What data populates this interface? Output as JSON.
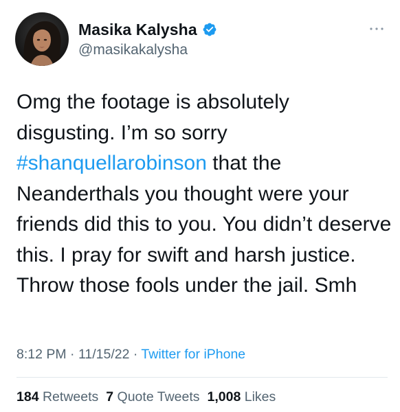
{
  "colors": {
    "accent": "#1d9bf0",
    "text_primary": "#0f1419",
    "text_secondary": "#536471",
    "divider": "#e1e8ed"
  },
  "author": {
    "display_name": "Masika Kalysha",
    "handle": "@masikakalysha",
    "verified_icon": "verified-badge-icon",
    "avatar_icon": "profile-photo"
  },
  "more_icon": "ellipsis-icon",
  "tweet": {
    "text_before": "Omg the footage is absolutely disgusting. I’m so sorry ",
    "hashtag": "#shanquellarobinson",
    "text_after": " that the Neanderthals you thought were your friends did this to you. You didn’t deserve this. I pray for swift and harsh justice. Throw those fools under the jail. Smh"
  },
  "meta": {
    "time": "8:12 PM",
    "separator": " · ",
    "date": "11/15/22",
    "source": "Twitter for iPhone"
  },
  "stats": {
    "retweets_count": "184",
    "retweets_label": "Retweets",
    "quotes_count": "7",
    "quotes_label": "Quote Tweets",
    "likes_count": "1,008",
    "likes_label": "Likes"
  }
}
